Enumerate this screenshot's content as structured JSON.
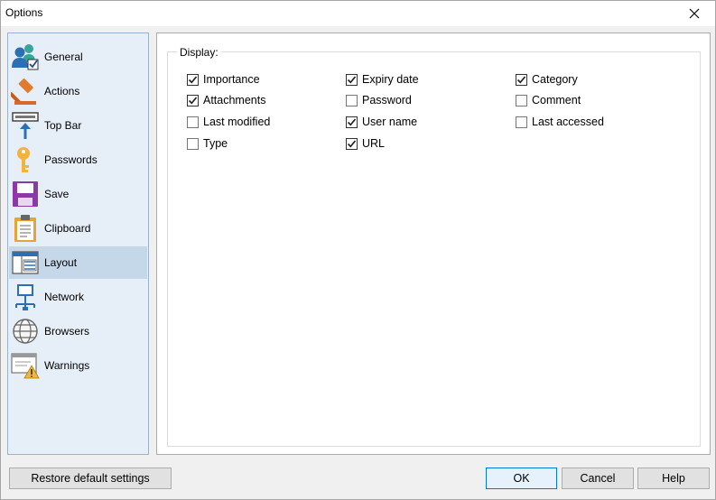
{
  "window": {
    "title": "Options"
  },
  "sidebar": {
    "items": [
      {
        "label": "General",
        "icon": "users-check-icon"
      },
      {
        "label": "Actions",
        "icon": "gavel-icon"
      },
      {
        "label": "Top Bar",
        "icon": "topbar-arrow-icon"
      },
      {
        "label": "Passwords",
        "icon": "key-icon"
      },
      {
        "label": "Save",
        "icon": "floppy-disk-icon"
      },
      {
        "label": "Clipboard",
        "icon": "clipboard-icon"
      },
      {
        "label": "Layout",
        "icon": "layout-window-icon"
      },
      {
        "label": "Network",
        "icon": "network-monitor-icon"
      },
      {
        "label": "Browsers",
        "icon": "globe-icon"
      },
      {
        "label": "Warnings",
        "icon": "warning-window-icon"
      }
    ],
    "selected": "Layout"
  },
  "display_group": {
    "title": "Display:",
    "options": [
      {
        "label": "Importance",
        "checked": true
      },
      {
        "label": "Expiry date",
        "checked": true
      },
      {
        "label": "Category",
        "checked": true
      },
      {
        "label": "Attachments",
        "checked": true
      },
      {
        "label": "Password",
        "checked": false
      },
      {
        "label": "Comment",
        "checked": false
      },
      {
        "label": "Last modified",
        "checked": false
      },
      {
        "label": "User name",
        "checked": true
      },
      {
        "label": "Last accessed",
        "checked": false
      },
      {
        "label": "Type",
        "checked": false
      },
      {
        "label": "URL",
        "checked": true
      }
    ]
  },
  "footer": {
    "restore_label": "Restore default settings",
    "ok_label": "OK",
    "cancel_label": "Cancel",
    "help_label": "Help"
  },
  "colors": {
    "sidebar_bg": "#e6eff8",
    "selected_bg": "#c5d8ea",
    "accent": "#0078d7"
  }
}
